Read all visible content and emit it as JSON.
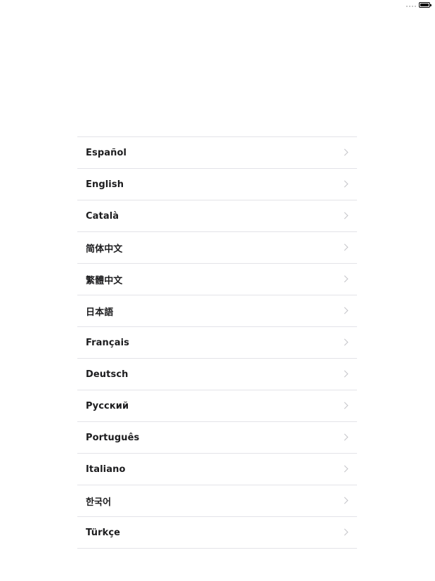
{
  "status_bar": {
    "signal_icon": "signal-dots-icon",
    "battery_icon": "battery-full-icon",
    "battery_level": 1.0
  },
  "language_list": {
    "items": [
      {
        "label": "Español"
      },
      {
        "label": "English"
      },
      {
        "label": "Català"
      },
      {
        "label": "简体中文"
      },
      {
        "label": "繁體中文"
      },
      {
        "label": "日本語"
      },
      {
        "label": "Français"
      },
      {
        "label": "Deutsch"
      },
      {
        "label": "Русский"
      },
      {
        "label": "Português"
      },
      {
        "label": "Italiano"
      },
      {
        "label": "한국어"
      },
      {
        "label": "Türkçe"
      }
    ],
    "chevron_icon": "chevron-right-icon"
  },
  "colors": {
    "background": "#ffffff",
    "text": "#1c1c1e",
    "separator": "#e3e3e8",
    "chevron": "#c4c4c8"
  }
}
